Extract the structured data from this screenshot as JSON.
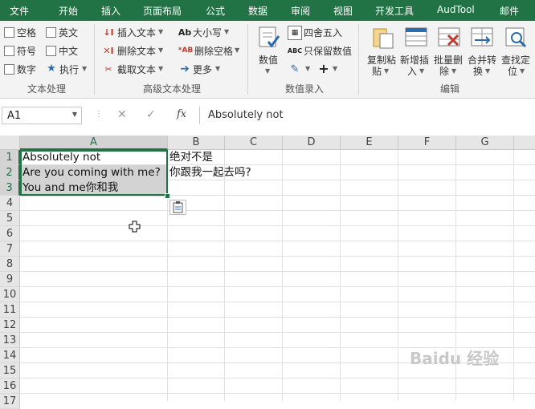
{
  "menu": [
    "文件",
    "开始",
    "插入",
    "页面布局",
    "公式",
    "数据",
    "审阅",
    "视图",
    "开发工具",
    "AudTool",
    "邮件"
  ],
  "ribbon": {
    "text_processing": {
      "checkboxes": [
        "空格",
        "英文",
        "符号",
        "中文",
        "数字"
      ],
      "execute": "执行",
      "label": "文本处理"
    },
    "advanced_text": {
      "insert_text": "插入文本",
      "delete_text": "删除文本",
      "extract_text": "截取文本",
      "case": "大小写",
      "delete_spaces": "删除空格",
      "more": "更多",
      "label": "高级文本处理"
    },
    "numeric_entry": {
      "numeric": "数值",
      "round": "四舍五入",
      "keep_value": "只保留数值",
      "label": "数值录入"
    },
    "editing": {
      "buttons": [
        {
          "line1": "复制粘",
          "line2": "贴"
        },
        {
          "line1": "新增插",
          "line2": "入"
        },
        {
          "line1": "批量删",
          "line2": "除"
        },
        {
          "line1": "合并转",
          "line2": "换"
        },
        {
          "line1": "查找定",
          "line2": "位"
        }
      ],
      "label": "编辑"
    }
  },
  "formula_bar": {
    "name_box": "A1",
    "cancel_glyph": "✕",
    "enter_glyph": "✓",
    "fx": "fx",
    "value": "Absolutely not"
  },
  "sheet": {
    "columns": [
      "A",
      "B",
      "C",
      "D",
      "E",
      "F",
      "G"
    ],
    "rows": [
      "1",
      "2",
      "3",
      "4",
      "5",
      "6",
      "7",
      "8",
      "9",
      "10",
      "11",
      "12",
      "13",
      "14",
      "15",
      "16",
      "17"
    ],
    "cells": {
      "A1": "Absolutely not",
      "A2": "Are you coming with me?",
      "A3": "You and me你和我",
      "B1": "绝对不是",
      "B2": "你跟我一起去吗?"
    },
    "selected_range": "A1:A3"
  },
  "watermark": "Baidu 经验"
}
